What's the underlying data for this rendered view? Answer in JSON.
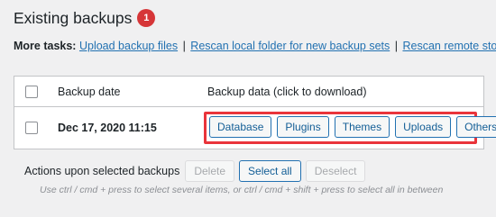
{
  "header": {
    "title": "Existing backups",
    "badge_count": "1"
  },
  "tasks": {
    "label": "More tasks:",
    "links": [
      "Upload backup files",
      "Rescan local folder for new backup sets",
      "Rescan remote storage"
    ],
    "separator": "|"
  },
  "table": {
    "columns": [
      "Backup date",
      "Backup data (click to download)"
    ],
    "rows": [
      {
        "date": "Dec 17, 2020 11:15",
        "buttons": [
          "Database",
          "Plugins",
          "Themes",
          "Uploads",
          "Others"
        ]
      }
    ],
    "highlight_color": "#e9343b"
  },
  "actions": {
    "label": "Actions upon selected backups",
    "delete": "Delete",
    "select_all": "Select all",
    "deselect": "Deselect",
    "hint": "Use ctrl / cmd + press to select several items, or ctrl / cmd + shift + press to select all in between"
  },
  "colors": {
    "link": "#2271b1",
    "badge": "#d63638",
    "background": "#f0f0f1"
  }
}
